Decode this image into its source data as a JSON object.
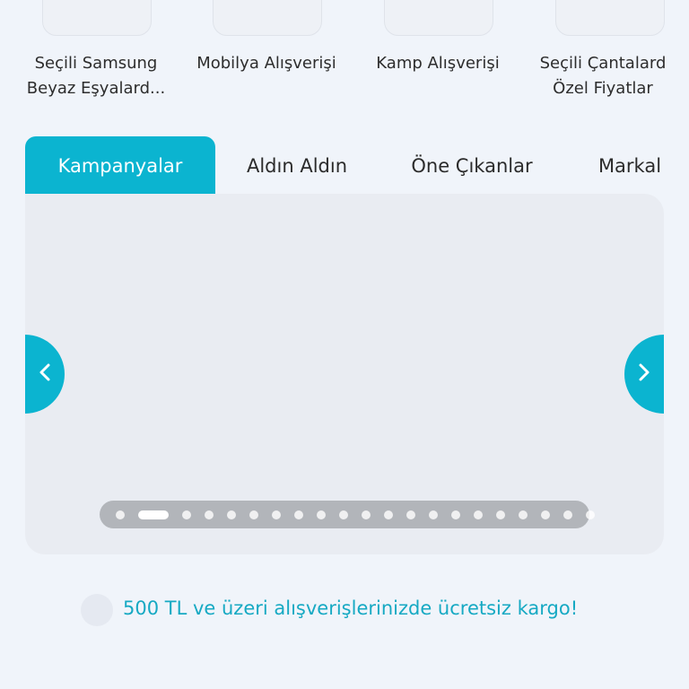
{
  "categories": [
    {
      "line1": "Seçili Samsung",
      "line2": "Beyaz Eşyalard..."
    },
    {
      "line1": "Mobilya Alışverişi",
      "line2": ""
    },
    {
      "line1": "Kamp Alışverişi",
      "line2": ""
    },
    {
      "line1": "Seçili Çantalard",
      "line2": "Özel Fiyatlar"
    }
  ],
  "tabs": [
    {
      "label": "Kampanyalar",
      "active": true
    },
    {
      "label": "Aldın Aldın",
      "active": false
    },
    {
      "label": "Öne Çıkanlar",
      "active": false
    },
    {
      "label": "Markal",
      "active": false
    }
  ],
  "carousel": {
    "prev_icon": "chevron-left-icon",
    "next_icon": "chevron-right-icon",
    "page_count": 21,
    "current_page": 2
  },
  "promo": {
    "text": "500 TL ve üzeri alışverişlerinizde ücretsiz kargo!",
    "icon": "cargo-icon"
  },
  "colors": {
    "accent": "#0bb4d0",
    "background": "#f0f4fa",
    "promo_text": "#16a9c3"
  }
}
